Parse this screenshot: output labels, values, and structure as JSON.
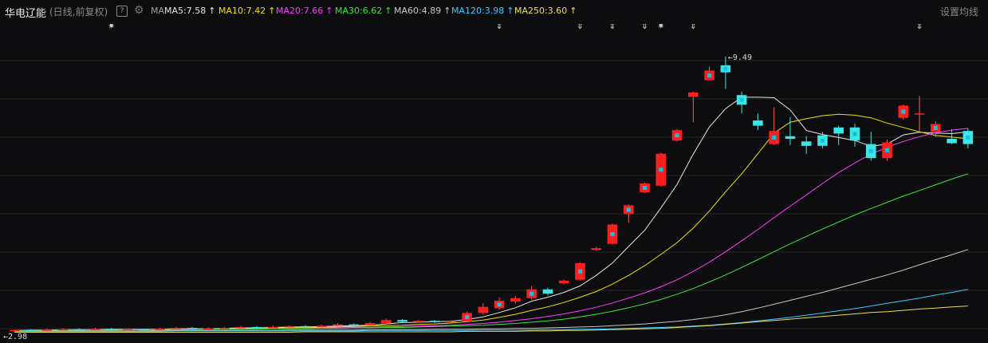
{
  "stock": {
    "name": "华电辽能",
    "period": "(日线,前复权)",
    "help": "?",
    "settings": "设置均线"
  },
  "ma_header": {
    "label": "MA",
    "items": [
      {
        "text": "MA5:7.58",
        "arrow": "↑",
        "color": "#e6e6e6"
      },
      {
        "text": "MA10:7.42",
        "arrow": "↑",
        "color": "#f0e000"
      },
      {
        "text": "MA20:7.66",
        "arrow": "↑",
        "color": "#ff3cff"
      },
      {
        "text": "MA30:6.62",
        "arrow": "↑",
        "color": "#3ce63c"
      },
      {
        "text": "MA60:4.89",
        "arrow": "↑",
        "color": "#c8c8c8"
      },
      {
        "text": "MA120:3.98",
        "arrow": "↑",
        "color": "#3cc8ff"
      },
      {
        "text": "MA250:3.60",
        "arrow": "↑",
        "color": "#e8e050"
      }
    ]
  },
  "chart_data": {
    "type": "candlestick",
    "y_max_label": "9.49",
    "y_min_label": "2.98",
    "ylim": [
      2.9,
      9.9
    ],
    "colors": {
      "up": "#ff5a5a",
      "up_fill": "#ff1e1e",
      "down": "#3ce6e6",
      "mark": "#18c0e0"
    },
    "candles": [
      [
        3.03,
        3.05,
        3.01,
        3.06
      ],
      [
        3.05,
        3.04,
        3.02,
        3.07
      ],
      [
        3.04,
        3.06,
        3.02,
        3.08
      ],
      [
        3.06,
        3.07,
        3.04,
        3.09
      ],
      [
        3.07,
        3.05,
        3.03,
        3.09
      ],
      [
        3.05,
        3.08,
        3.04,
        3.1
      ],
      [
        3.08,
        3.06,
        3.04,
        3.1
      ],
      [
        3.06,
        3.07,
        3.05,
        3.09
      ],
      [
        3.07,
        3.06,
        3.04,
        3.08
      ],
      [
        3.06,
        3.08,
        3.05,
        3.1
      ],
      [
        3.08,
        3.1,
        3.06,
        3.12
      ],
      [
        3.1,
        3.08,
        3.06,
        3.12
      ],
      [
        3.08,
        3.09,
        3.07,
        3.11
      ],
      [
        3.09,
        3.1,
        3.07,
        3.12
      ],
      [
        3.1,
        3.12,
        3.08,
        3.14
      ],
      [
        3.12,
        3.1,
        3.08,
        3.14
      ],
      [
        3.1,
        3.12,
        3.09,
        3.15
      ],
      [
        3.12,
        3.14,
        3.1,
        3.16
      ],
      [
        3.14,
        3.12,
        3.1,
        3.16
      ],
      [
        3.12,
        3.15,
        3.11,
        3.17
      ],
      [
        3.15,
        3.18,
        3.13,
        3.21
      ],
      [
        3.18,
        3.16,
        3.14,
        3.2
      ],
      [
        3.16,
        3.21,
        3.15,
        3.23
      ],
      [
        3.21,
        3.28,
        3.19,
        3.31
      ],
      [
        3.28,
        3.24,
        3.21,
        3.3
      ],
      [
        3.24,
        3.26,
        3.22,
        3.28
      ],
      [
        3.26,
        3.23,
        3.21,
        3.28
      ],
      [
        3.23,
        3.25,
        3.22,
        3.27
      ],
      [
        3.25,
        3.44,
        3.24,
        3.47
      ],
      [
        3.44,
        3.58,
        3.4,
        3.66
      ],
      [
        3.55,
        3.72,
        3.52,
        3.8
      ],
      [
        3.7,
        3.78,
        3.66,
        3.82
      ],
      [
        3.78,
        3.98,
        3.74,
        4.06
      ],
      [
        3.98,
        3.88,
        3.84,
        4.02
      ],
      [
        4.12,
        4.18,
        4.1,
        4.2
      ],
      [
        4.2,
        4.58,
        4.18,
        4.6
      ],
      [
        4.88,
        4.92,
        4.86,
        4.95
      ],
      [
        5.02,
        5.46,
        5.0,
        5.48
      ],
      [
        5.7,
        5.9,
        5.5,
        5.92
      ],
      [
        6.2,
        6.4,
        6.18,
        6.42
      ],
      [
        6.35,
        7.08,
        6.33,
        7.1
      ],
      [
        7.38,
        7.62,
        7.36,
        7.64
      ],
      [
        8.38,
        8.48,
        7.8,
        8.5
      ],
      [
        8.76,
        8.98,
        8.76,
        9.07
      ],
      [
        9.1,
        8.94,
        8.56,
        9.3
      ],
      [
        8.42,
        8.2,
        8.0,
        8.5
      ],
      [
        7.84,
        7.72,
        7.62,
        8.0
      ],
      [
        7.3,
        7.6,
        7.28,
        8.14
      ],
      [
        7.48,
        7.42,
        7.28,
        7.92
      ],
      [
        7.36,
        7.26,
        7.08,
        7.48
      ],
      [
        7.5,
        7.26,
        7.2,
        7.58
      ],
      [
        7.68,
        7.54,
        7.28,
        7.72
      ],
      [
        7.68,
        7.38,
        7.24,
        7.76
      ],
      [
        7.3,
        6.98,
        6.92,
        7.58
      ],
      [
        6.98,
        7.34,
        6.92,
        7.4
      ],
      [
        7.9,
        8.18,
        7.86,
        8.2
      ],
      [
        7.98,
        8.0,
        7.6,
        8.4
      ],
      [
        7.58,
        7.76,
        7.46,
        7.82
      ],
      [
        7.42,
        7.32,
        7.3,
        7.64
      ],
      [
        7.6,
        7.3,
        7.2,
        7.66
      ]
    ],
    "ma_lines": [
      {
        "name": "MA5",
        "values": [
          3.04,
          3.05,
          3.05,
          3.06,
          3.06,
          3.06,
          3.07,
          3.07,
          3.07,
          3.07,
          3.08,
          3.08,
          3.08,
          3.09,
          3.1,
          3.1,
          3.11,
          3.12,
          3.12,
          3.13,
          3.14,
          3.15,
          3.16,
          3.19,
          3.22,
          3.23,
          3.24,
          3.25,
          3.29,
          3.35,
          3.45,
          3.56,
          3.71,
          3.8,
          3.91,
          4.06,
          4.3,
          4.58,
          4.96,
          5.33,
          5.84,
          6.38,
          7.07,
          7.69,
          8.11,
          8.37,
          8.37,
          8.36,
          8.08,
          7.61,
          7.52,
          7.45,
          7.38,
          7.25,
          7.3,
          7.51,
          7.57,
          7.55,
          7.54,
          7.58
        ]
      },
      {
        "name": "MA10",
        "values": [
          3.04,
          3.04,
          3.05,
          3.05,
          3.05,
          3.06,
          3.06,
          3.06,
          3.06,
          3.07,
          3.07,
          3.07,
          3.08,
          3.08,
          3.09,
          3.09,
          3.1,
          3.1,
          3.11,
          3.11,
          3.12,
          3.13,
          3.14,
          3.15,
          3.16,
          3.18,
          3.19,
          3.21,
          3.24,
          3.28,
          3.34,
          3.41,
          3.5,
          3.58,
          3.68,
          3.8,
          3.93,
          4.1,
          4.3,
          4.52,
          4.78,
          5.05,
          5.38,
          5.77,
          6.21,
          6.62,
          7.08,
          7.55,
          7.8,
          7.88,
          7.95,
          7.98,
          7.96,
          7.9,
          7.78,
          7.68,
          7.58,
          7.5,
          7.46,
          7.42
        ]
      },
      {
        "name": "MA20",
        "values": [
          3.04,
          3.04,
          3.04,
          3.05,
          3.05,
          3.05,
          3.05,
          3.06,
          3.06,
          3.06,
          3.06,
          3.07,
          3.07,
          3.07,
          3.07,
          3.08,
          3.08,
          3.09,
          3.09,
          3.1,
          3.1,
          3.11,
          3.11,
          3.12,
          3.13,
          3.14,
          3.15,
          3.16,
          3.18,
          3.2,
          3.23,
          3.27,
          3.31,
          3.36,
          3.42,
          3.49,
          3.57,
          3.67,
          3.78,
          3.9,
          4.04,
          4.2,
          4.39,
          4.6,
          4.84,
          5.09,
          5.35,
          5.62,
          5.88,
          6.14,
          6.4,
          6.65,
          6.87,
          7.07,
          7.23,
          7.36,
          7.47,
          7.56,
          7.62,
          7.66
        ]
      },
      {
        "name": "MA30",
        "values": [
          3.04,
          3.04,
          3.04,
          3.04,
          3.05,
          3.05,
          3.05,
          3.05,
          3.06,
          3.06,
          3.06,
          3.06,
          3.07,
          3.07,
          3.07,
          3.07,
          3.08,
          3.08,
          3.08,
          3.09,
          3.09,
          3.1,
          3.1,
          3.11,
          3.11,
          3.12,
          3.13,
          3.14,
          3.15,
          3.16,
          3.18,
          3.2,
          3.23,
          3.26,
          3.3,
          3.35,
          3.41,
          3.48,
          3.56,
          3.65,
          3.75,
          3.87,
          4.0,
          4.15,
          4.31,
          4.48,
          4.66,
          4.84,
          5.02,
          5.19,
          5.36,
          5.52,
          5.68,
          5.83,
          5.97,
          6.11,
          6.24,
          6.37,
          6.5,
          6.62
        ]
      },
      {
        "name": "MA60",
        "values": [
          3.03,
          3.03,
          3.03,
          3.03,
          3.03,
          3.03,
          3.03,
          3.03,
          3.03,
          3.04,
          3.04,
          3.04,
          3.04,
          3.04,
          3.04,
          3.04,
          3.04,
          3.05,
          3.05,
          3.05,
          3.05,
          3.05,
          3.06,
          3.06,
          3.06,
          3.06,
          3.07,
          3.07,
          3.07,
          3.08,
          3.08,
          3.09,
          3.09,
          3.1,
          3.11,
          3.12,
          3.13,
          3.15,
          3.17,
          3.19,
          3.22,
          3.25,
          3.29,
          3.34,
          3.4,
          3.47,
          3.55,
          3.64,
          3.73,
          3.82,
          3.91,
          4.01,
          4.11,
          4.21,
          4.31,
          4.42,
          4.54,
          4.66,
          4.77,
          4.89
        ]
      },
      {
        "name": "MA120",
        "values": [
          3.02,
          3.02,
          3.02,
          3.02,
          3.02,
          3.02,
          3.02,
          3.02,
          3.02,
          3.02,
          3.03,
          3.03,
          3.03,
          3.03,
          3.03,
          3.03,
          3.03,
          3.03,
          3.03,
          3.03,
          3.03,
          3.03,
          3.04,
          3.04,
          3.04,
          3.04,
          3.04,
          3.04,
          3.04,
          3.05,
          3.05,
          3.05,
          3.05,
          3.06,
          3.06,
          3.07,
          3.07,
          3.08,
          3.09,
          3.1,
          3.11,
          3.12,
          3.14,
          3.16,
          3.19,
          3.22,
          3.26,
          3.3,
          3.34,
          3.39,
          3.44,
          3.49,
          3.54,
          3.6,
          3.66,
          3.72,
          3.78,
          3.85,
          3.91,
          3.98
        ]
      },
      {
        "name": "MA250",
        "values": [
          3.0,
          3.0,
          3.0,
          3.0,
          3.0,
          3.0,
          3.0,
          3.0,
          3.0,
          3.0,
          3.0,
          3.0,
          3.0,
          3.0,
          3.0,
          3.0,
          3.0,
          3.0,
          3.01,
          3.01,
          3.01,
          3.01,
          3.01,
          3.01,
          3.01,
          3.01,
          3.01,
          3.01,
          3.02,
          3.02,
          3.02,
          3.02,
          3.03,
          3.03,
          3.04,
          3.04,
          3.05,
          3.06,
          3.07,
          3.08,
          3.09,
          3.11,
          3.13,
          3.15,
          3.18,
          3.21,
          3.24,
          3.27,
          3.3,
          3.33,
          3.36,
          3.39,
          3.42,
          3.45,
          3.47,
          3.5,
          3.53,
          3.55,
          3.58,
          3.6
        ]
      }
    ],
    "event_markers": [
      {
        "candle": 6,
        "symbol": "✷"
      },
      {
        "candle": 30,
        "symbol": "⇕"
      },
      {
        "candle": 35,
        "symbol": "⇕"
      },
      {
        "candle": 37,
        "symbol": "⇕"
      },
      {
        "candle": 39,
        "symbol": "⇕"
      },
      {
        "candle": 40,
        "symbol": "✷"
      },
      {
        "candle": 42,
        "symbol": "⇕"
      },
      {
        "candle": 56,
        "symbol": "⇕"
      }
    ]
  }
}
